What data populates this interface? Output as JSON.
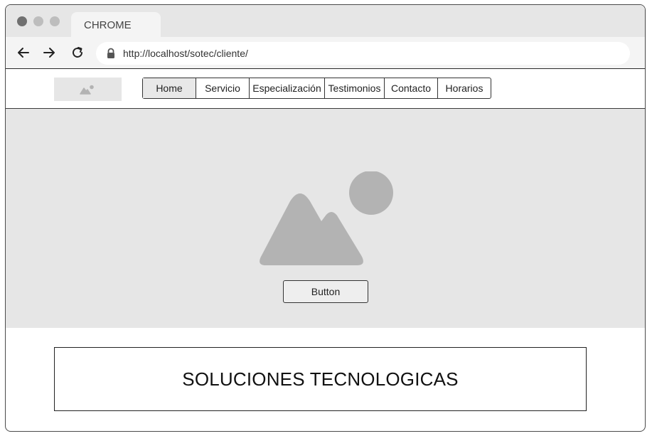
{
  "browser": {
    "tab_title": "CHROME",
    "url": "http://localhost/sotec/cliente/",
    "controls": {
      "window_dots": [
        "#707070",
        "#bdbdbd",
        "#bdbdbd"
      ],
      "back_icon": "arrow-left",
      "forward_icon": "arrow-right",
      "reload_icon": "reload",
      "lock_icon": "lock"
    }
  },
  "header": {
    "logo_icon": "image-placeholder",
    "nav": [
      {
        "label": "Home",
        "active": true
      },
      {
        "label": "Servicio"
      },
      {
        "label": "Especialización"
      },
      {
        "label": "Testimonios"
      },
      {
        "label": "Contacto"
      },
      {
        "label": "Horarios"
      }
    ]
  },
  "hero": {
    "image_icon": "image-placeholder",
    "button_label": "Button"
  },
  "main": {
    "title": "SOLUCIONES TECNOLOGICAS"
  },
  "colors": {
    "placeholder_bg": "#e6e6e6",
    "placeholder_icon": "#b3b3b3",
    "border": "#333333"
  }
}
